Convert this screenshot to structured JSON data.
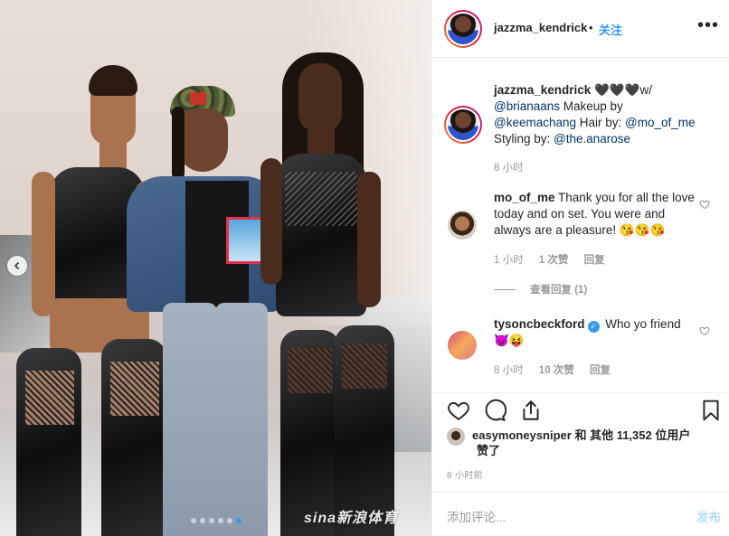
{
  "post": {
    "author": "jazzma_kendrick",
    "separator": "•",
    "follow_label": "关注",
    "more_icon": "more-horizontal-icon"
  },
  "caption": {
    "username": "jazzma_kendrick",
    "hearts": "🖤🖤🖤",
    "text_1": "w/",
    "mention_1": "@brianaans",
    "text_2": " Makeup by",
    "mention_2": "@keemachang",
    "text_3": " Hair by: ",
    "mention_3": "@mo_of_me",
    "text_4": "Styling by: ",
    "mention_4": "@the.anarose",
    "time": "8 小时"
  },
  "comments": [
    {
      "username": "mo_of_me",
      "text": "Thank you for all the love today and on set. You were and always are a pleasure!",
      "emoji": "😘😘😘",
      "time": "1 小时",
      "likes": "1 次赞",
      "reply": "回复",
      "view_replies": "查看回复 (1)"
    },
    {
      "username": "tysoncbeckford",
      "verified": "✓",
      "text": "Who yo friend",
      "emoji": "😈😝",
      "time": "8 小时",
      "likes": "10 次赞",
      "reply": "回复"
    }
  ],
  "actions": {
    "like_icon": "heart-icon",
    "comment_icon": "comment-icon",
    "share_icon": "share-icon",
    "save_icon": "bookmark-icon"
  },
  "likes": {
    "user": "easymoneysniper",
    "mid": " 和 其他 ",
    "count": "11,352",
    "suffix": " 位用户",
    "line2": "赞了"
  },
  "timestamp": "8 小时前",
  "add_comment": {
    "placeholder": "添加评论...",
    "post_label": "发布"
  },
  "carousel": {
    "total_slides": 6,
    "active_slide": 6,
    "prev_icon": "chevron-left-icon"
  },
  "watermark": "sina新浪体育"
}
